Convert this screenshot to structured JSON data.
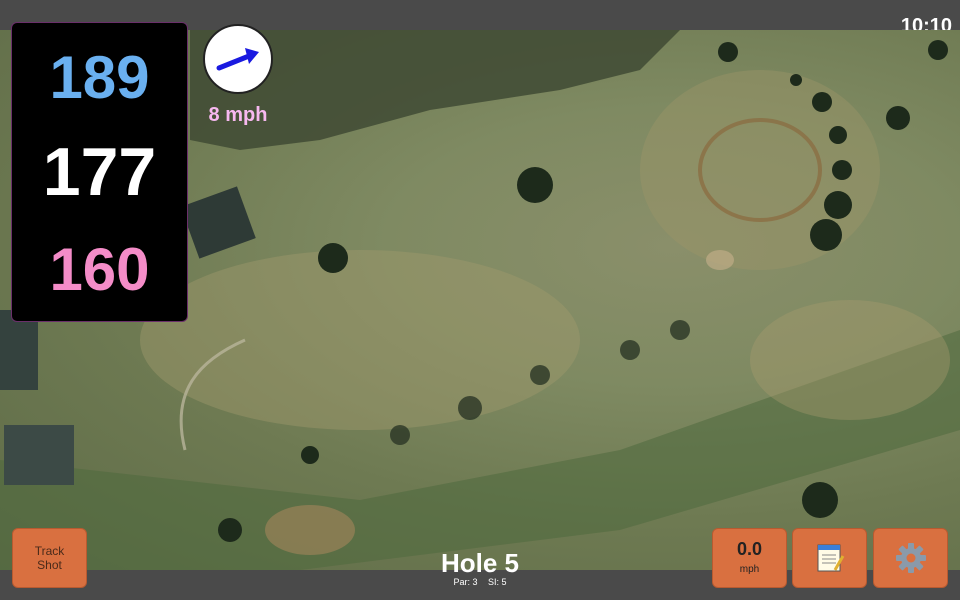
{
  "clock": "10:10",
  "yardages": {
    "back": "189",
    "middle": "177",
    "front": "160"
  },
  "wind": {
    "speed_text": "8 mph",
    "icon": "wind-arrow-icon"
  },
  "buttons": {
    "track_shot_line1": "Track",
    "track_shot_line2": "Shot",
    "speed_value": "0.0",
    "speed_unit": "mph",
    "notes_icon": "notepad-icon",
    "settings_icon": "gear-icon"
  },
  "hole": {
    "title": "Hole 5",
    "par": "Par: 3",
    "si": "SI: 5"
  },
  "colors": {
    "back": "#6ab0f0",
    "middle": "#ffffff",
    "front": "#f48cc8",
    "button": "#d97040",
    "wind_text": "#f7b8f0"
  }
}
